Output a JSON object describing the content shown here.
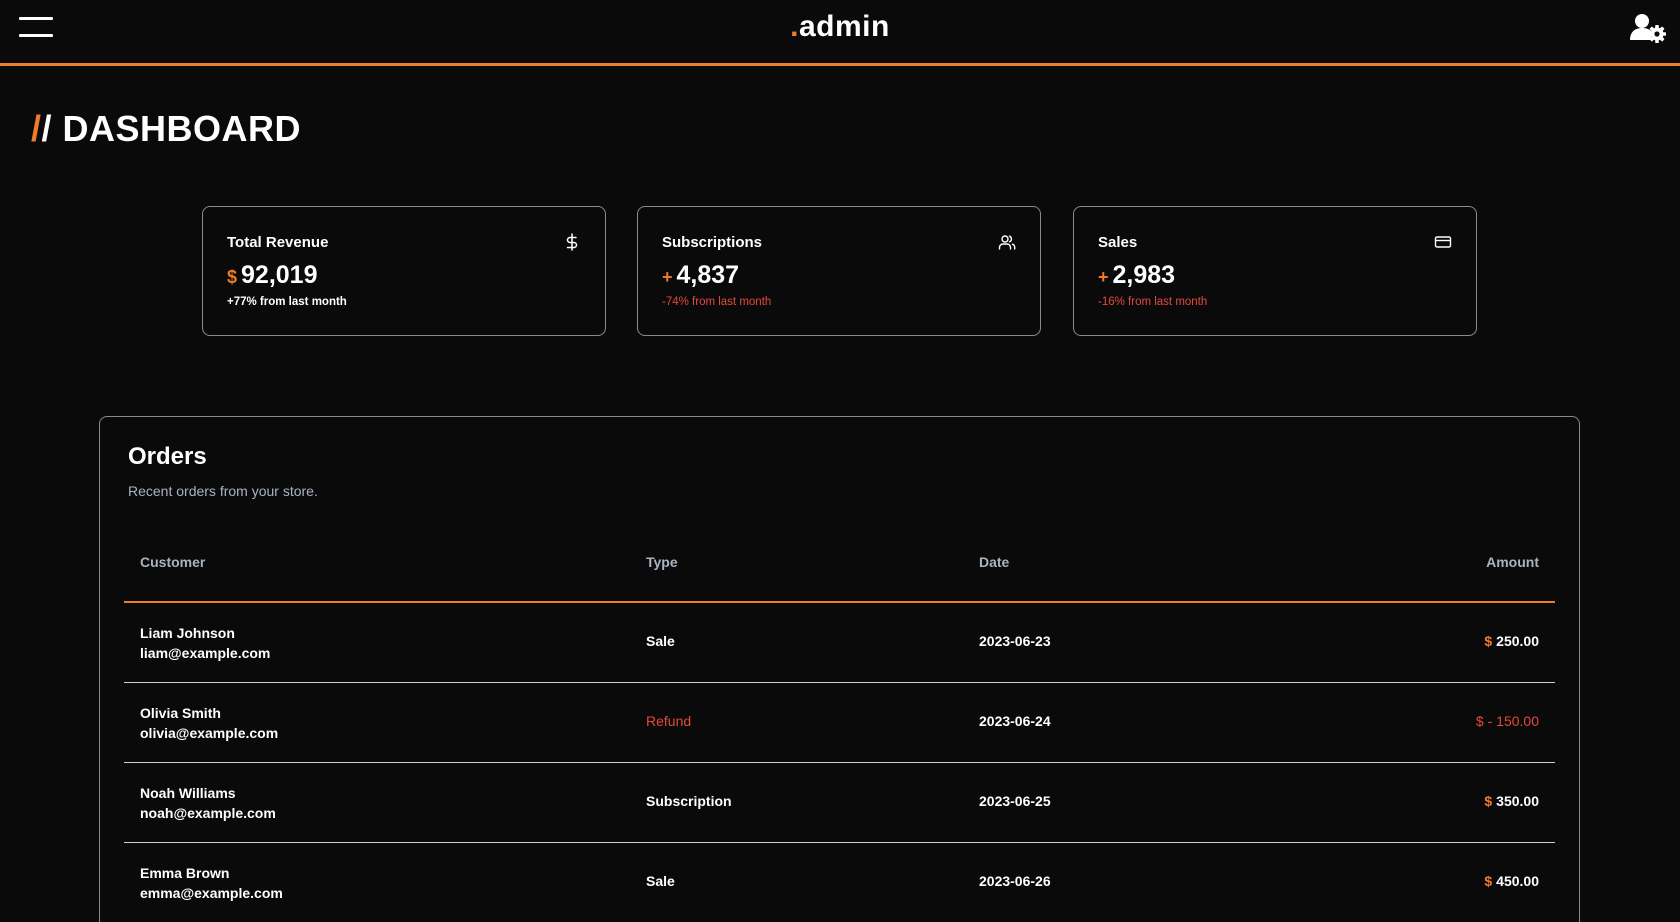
{
  "header": {
    "brand_dot": ".",
    "brand_name": "admin",
    "icons": {
      "menu": "hamburger-menu-icon",
      "user": "user-settings-icon"
    }
  },
  "page": {
    "title_slash_1": "/",
    "title_slash_2": "/",
    "title": "DASHBOARD"
  },
  "stats": [
    {
      "label": "Total Revenue",
      "icon": "dollar-icon",
      "prefix": "$",
      "value": "92,019",
      "change": "+77% from last month",
      "trend": "positive"
    },
    {
      "label": "Subscriptions",
      "icon": "users-icon",
      "prefix": "+",
      "value": "4,837",
      "change": "-74% from last month",
      "trend": "negative"
    },
    {
      "label": "Sales",
      "icon": "credit-card-icon",
      "prefix": "+",
      "value": "2,983",
      "change": "-16% from last month",
      "trend": "negative"
    }
  ],
  "orders": {
    "title": "Orders",
    "subtitle": "Recent orders from your store.",
    "columns": {
      "customer": "Customer",
      "type": "Type",
      "date": "Date",
      "amount": "Amount"
    },
    "rows": [
      {
        "name": "Liam Johnson",
        "email": "liam@example.com",
        "type": "Sale",
        "date": "2023-06-23",
        "currency": "$",
        "amount": "250.00"
      },
      {
        "name": "Olivia Smith",
        "email": "olivia@example.com",
        "type": "Refund",
        "date": "2023-06-24",
        "currency": "$",
        "amount": "- 150.00"
      },
      {
        "name": "Noah Williams",
        "email": "noah@example.com",
        "type": "Subscription",
        "date": "2023-06-25",
        "currency": "$",
        "amount": "350.00"
      },
      {
        "name": "Emma Brown",
        "email": "emma@example.com",
        "type": "Sale",
        "date": "2023-06-26",
        "currency": "$",
        "amount": "450.00"
      }
    ]
  },
  "colors": {
    "accent": "#f07b2c",
    "negative": "#e5483d",
    "background": "#0a0a0a",
    "muted": "#aab3c3"
  }
}
